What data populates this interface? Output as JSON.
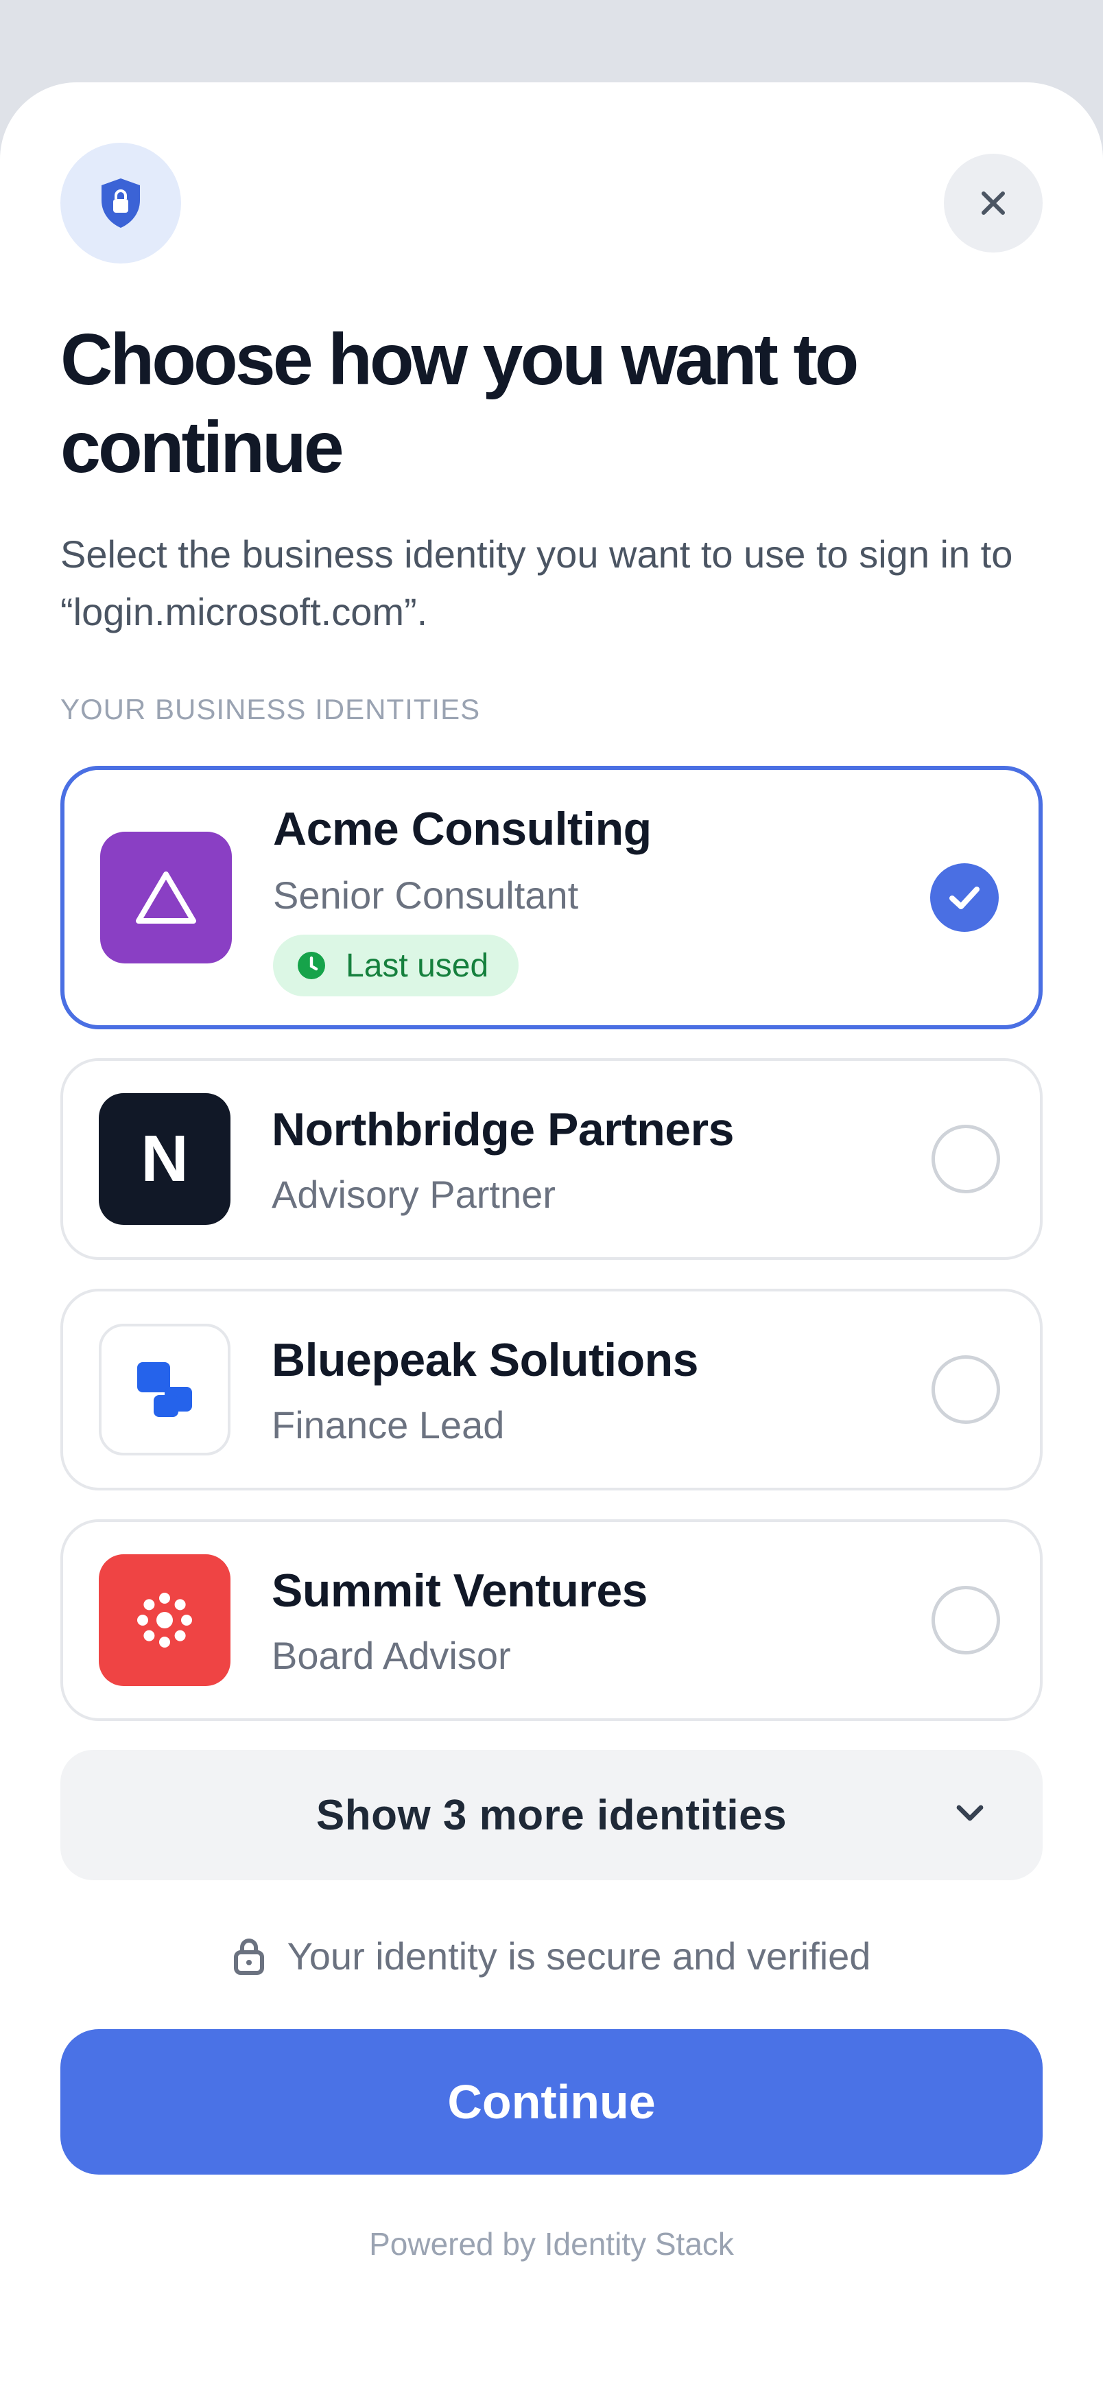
{
  "dialog": {
    "title": "Choose how you want to continue",
    "subtitle": "Select the business identity you want to use to sign in to “login.microsoft.com”.",
    "section_label": "YOUR BUSINESS IDENTITIES",
    "header_icon": "shield-lock-icon",
    "close_icon": "close-icon"
  },
  "identities": [
    {
      "name": "Acme Consulting",
      "role": "Senior Consultant",
      "badge": "Last used",
      "selected": true,
      "logo_icon": "triangle-icon",
      "logo_color": "#8a3fc4"
    },
    {
      "name": "Northbridge Partners",
      "role": "Advisory Partner",
      "selected": false,
      "logo_letter": "N",
      "logo_color": "#111827"
    },
    {
      "name": "Bluepeak Solutions",
      "role": "Finance Lead",
      "selected": false,
      "logo_icon": "blue-squares-icon",
      "logo_color": "#ffffff"
    },
    {
      "name": "Summit Ventures",
      "role": "Board Advisor",
      "selected": false,
      "logo_icon": "dot-burst-icon",
      "logo_color": "#ef4444"
    }
  ],
  "more": {
    "label": "Show 3 more identities",
    "icon": "chevron-down-icon"
  },
  "security": {
    "text": "Your identity is secure and verified",
    "icon": "lock-icon"
  },
  "continue_label": "Continue",
  "footer": "Powered by Identity Stack",
  "colors": {
    "accent": "#4a72e6",
    "selected_border": "#4a6fe3",
    "badge_bg": "#dcf7e5",
    "badge_text": "#15803d"
  }
}
